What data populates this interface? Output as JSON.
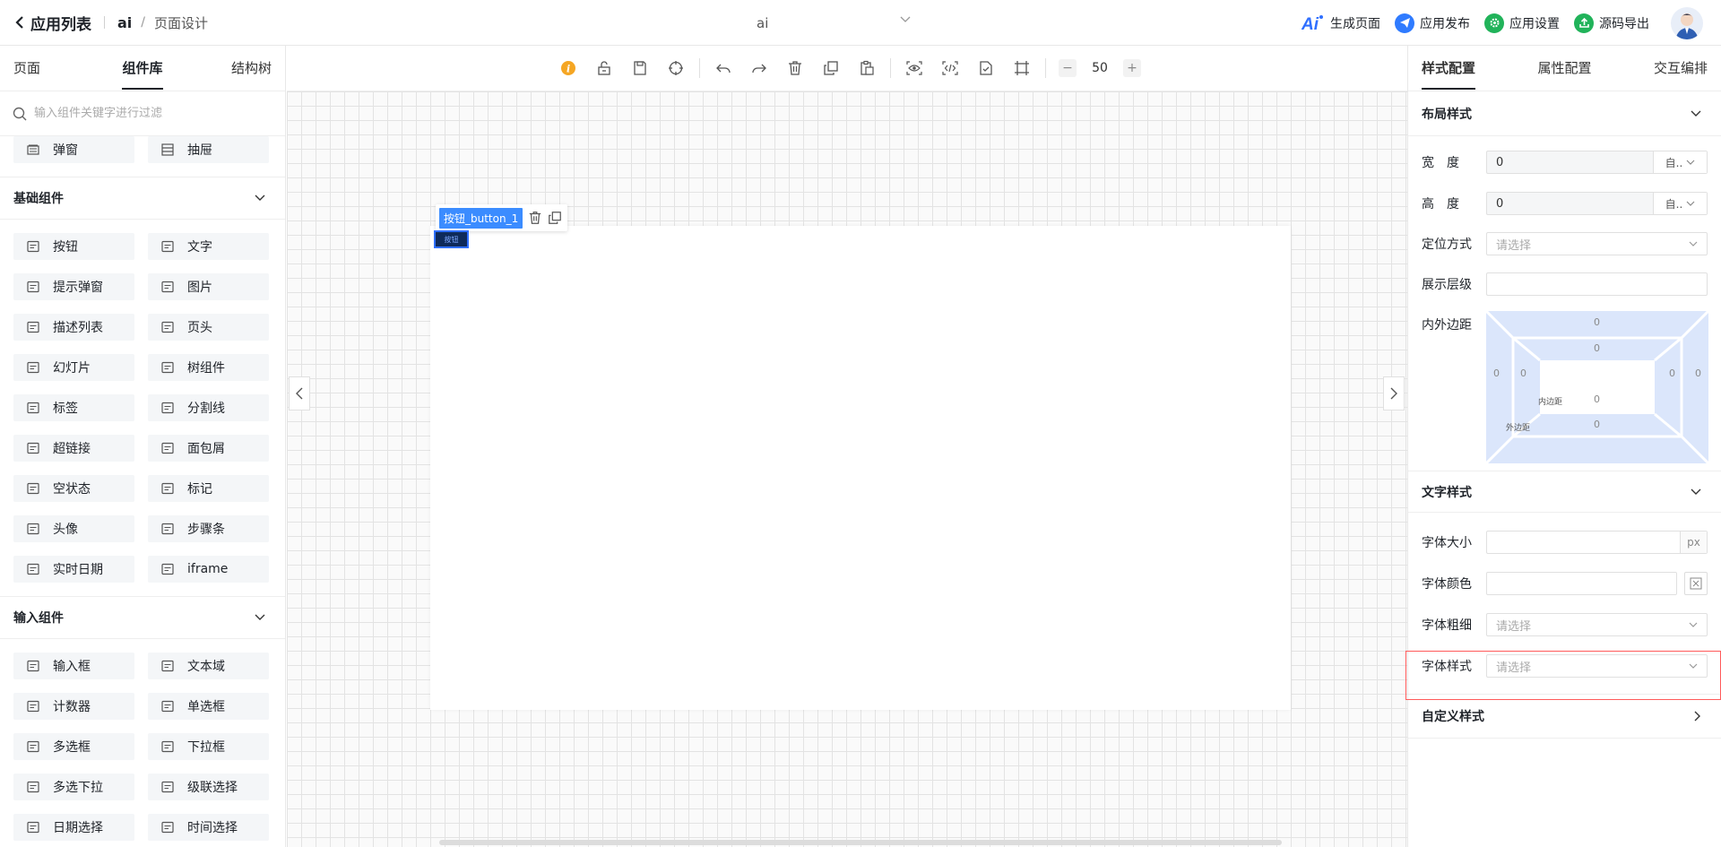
{
  "topbar": {
    "back_label": "应用列表",
    "app_name": "ai",
    "page_name": "页面设计",
    "center_app": "ai",
    "actions": [
      "生成页面",
      "应用发布",
      "应用设置",
      "源码导出"
    ]
  },
  "left": {
    "tabs": [
      "页面",
      "组件库",
      "结构树"
    ],
    "active_tab": "组件库",
    "search_placeholder": "输入组件关键字进行过滤",
    "top_items": [
      "弹窗",
      "抽屉"
    ],
    "sections": [
      {
        "title": "基础组件",
        "items": [
          "按钮",
          "文字",
          "提示弹窗",
          "图片",
          "描述列表",
          "页头",
          "幻灯片",
          "树组件",
          "标签",
          "分割线",
          "超链接",
          "面包屑",
          "空状态",
          "标记",
          "头像",
          "步骤条",
          "实时日期",
          "iframe"
        ]
      },
      {
        "title": "输入组件",
        "items": [
          "输入框",
          "文本域",
          "计数器",
          "单选框",
          "多选框",
          "下拉框",
          "多选下拉",
          "级联选择",
          "日期选择",
          "时间选择"
        ]
      }
    ]
  },
  "toolbar": {
    "zoom": "50",
    "zoom_minus": "−",
    "zoom_plus": "+"
  },
  "canvas": {
    "selected_label": "按钮_button_1",
    "button_text": "按钮"
  },
  "right": {
    "tabs": [
      "样式配置",
      "属性配置",
      "交互编排"
    ],
    "active_tab": "样式配置",
    "layout_title": "布局样式",
    "width_label": "宽　度",
    "width_value": "0",
    "width_unit": "自..",
    "height_label": "高　度",
    "height_value": "0",
    "height_unit": "自..",
    "position_label": "定位方式",
    "position_placeholder": "请选择",
    "zindex_label": "展示层级",
    "padding_label": "内外边距",
    "box": {
      "outer_top": "0",
      "outer_left": "0",
      "outer_right": "0",
      "outer_bottom": "0",
      "inner_top": "0",
      "inner_left": "0",
      "inner_right": "0",
      "inner_bottom": "0",
      "inner_label": "内边距",
      "outer_label": "外边距"
    },
    "text_title": "文字样式",
    "font_size_label": "字体大小",
    "font_size_unit": "px",
    "font_color_label": "字体颜色",
    "font_weight_label": "字体粗细",
    "font_weight_placeholder": "请选择",
    "font_style_label": "字体样式",
    "font_style_placeholder": "请选择",
    "custom_title": "自定义样式"
  },
  "colors": {
    "accent": "#3b8cff",
    "highlight": "#ff5a5a",
    "box_fill": "#dbe6fb"
  }
}
